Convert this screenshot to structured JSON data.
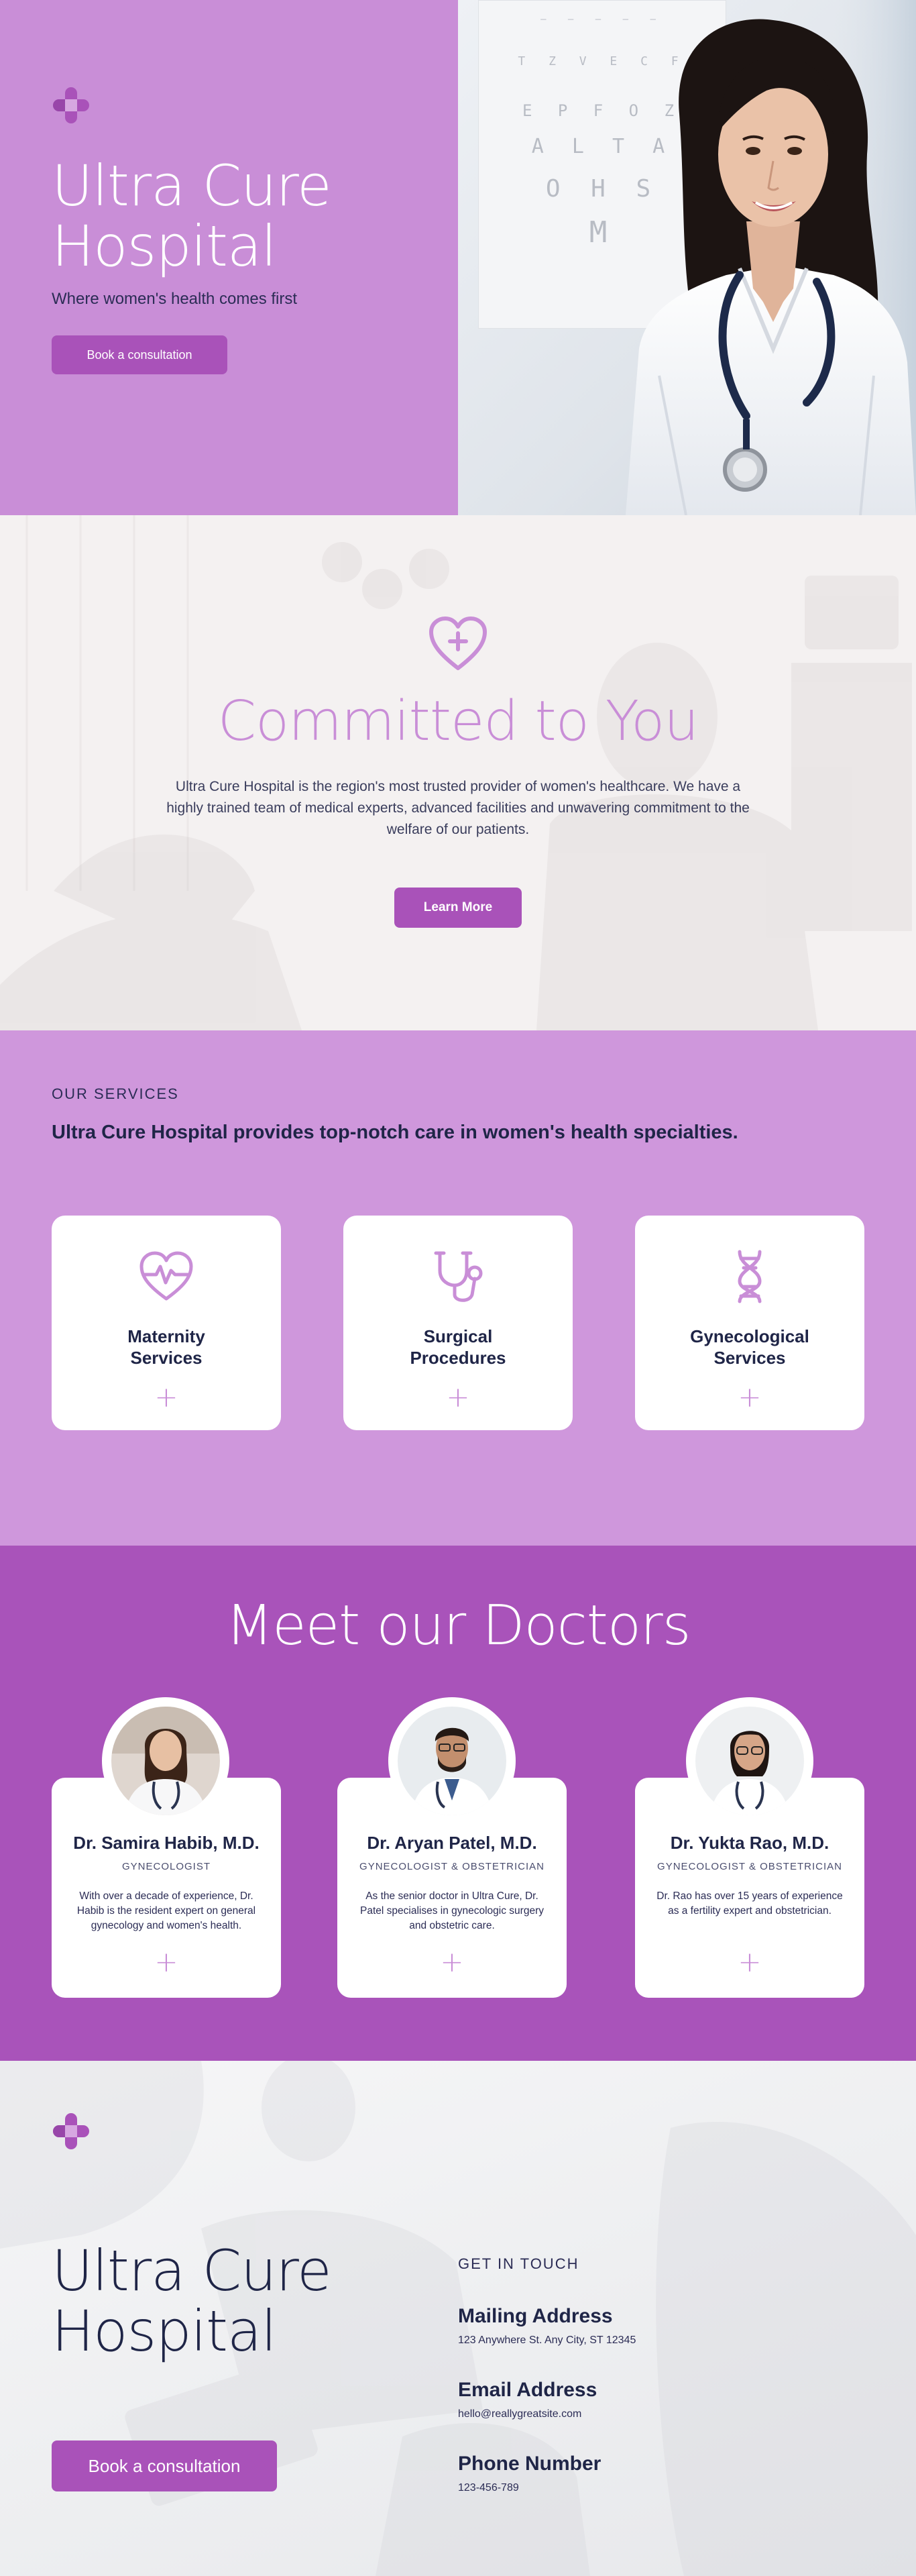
{
  "hero": {
    "title_line1": "Ultra Cure",
    "title_line2": "Hospital",
    "subtitle": "Where women's health comes first",
    "cta_label": "Book a consultation"
  },
  "committed": {
    "title": "Committed to You",
    "text": "Ultra Cure Hospital is the region's most trusted provider of women's healthcare. We have a highly trained team of medical experts, advanced facilities and unwavering commitment to the welfare of our patients.",
    "cta_label": "Learn More"
  },
  "services": {
    "eyebrow": "OUR SERVICES",
    "heading": "Ultra Cure Hospital provides top-notch care in women's health specialties.",
    "items": [
      {
        "name_line1": "Maternity",
        "name_line2": "Services",
        "icon": "heart-pulse-icon",
        "plus": "+"
      },
      {
        "name_line1": "Surgical",
        "name_line2": "Procedures",
        "icon": "stethoscope-icon",
        "plus": "+"
      },
      {
        "name_line1": "Gynecological",
        "name_line2": "Services",
        "icon": "dna-icon",
        "plus": "+"
      }
    ]
  },
  "doctors": {
    "title": "Meet our Doctors",
    "items": [
      {
        "name": "Dr. Samira Habib, M.D.",
        "role": "GYNECOLOGIST",
        "bio": "With over a decade of experience, Dr. Habib is the resident expert on general gynecology and women's health.",
        "plus": "+"
      },
      {
        "name": "Dr. Aryan Patel, M.D.",
        "role": "GYNECOLOGIST & OBSTETRICIAN",
        "bio": "As the senior doctor in Ultra Cure, Dr. Patel specialises in gynecologic surgery and obstetric care.",
        "plus": "+"
      },
      {
        "name": "Dr. Yukta Rao, M.D.",
        "role": "GYNECOLOGIST & OBSTETRICIAN",
        "bio": "Dr. Rao has over 15 years of experience as a fertility expert and obstetrician.",
        "plus": "+"
      }
    ]
  },
  "contact": {
    "title_line1": "Ultra Cure",
    "title_line2": "Hospital",
    "cta_label": "Book a consultation",
    "eyebrow": "GET IN TOUCH",
    "mailing_label": "Mailing Address",
    "mailing_value": "123 Anywhere St. Any City, ST 12345",
    "email_label": "Email Address",
    "email_value": "hello@reallygreatsite.com",
    "phone_label": "Phone Number",
    "phone_value": "123-456-789"
  },
  "colors": {
    "lilac": "#c98ed7",
    "lilac_light": "#cf97dc",
    "purple": "#a953ba",
    "navy": "#1f2547"
  }
}
